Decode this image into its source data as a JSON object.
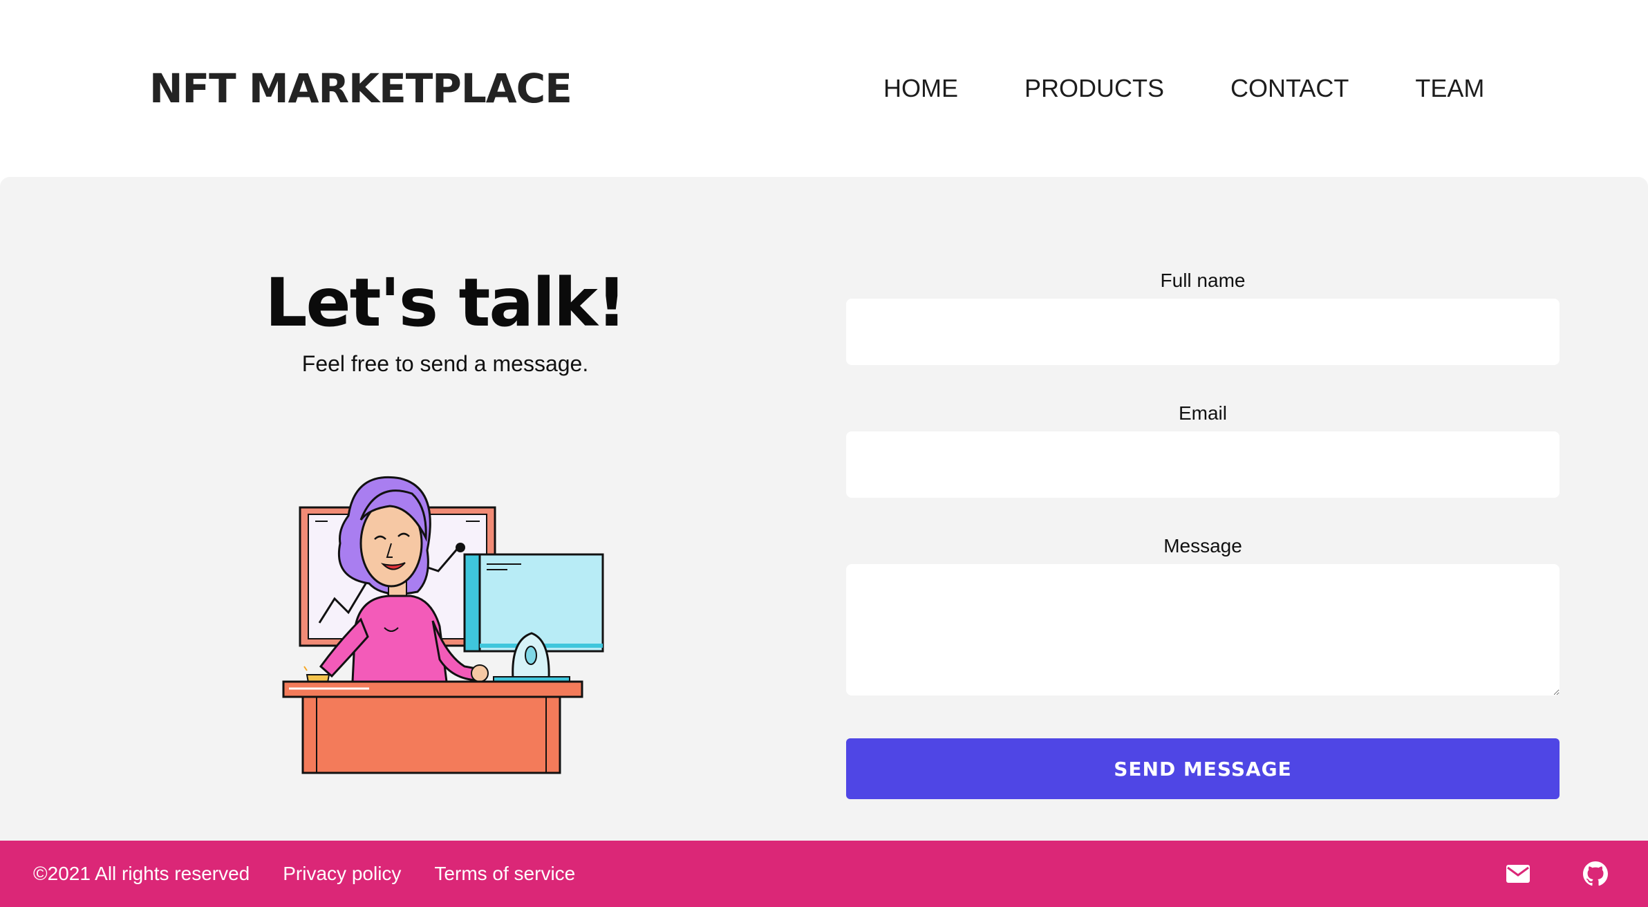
{
  "header": {
    "logo": "NFT MARKETPLACE",
    "nav": [
      {
        "label": "HOME"
      },
      {
        "label": "PRODUCTS"
      },
      {
        "label": "CONTACT"
      },
      {
        "label": "TEAM"
      }
    ]
  },
  "hero": {
    "title": "Let's talk!",
    "subtitle": "Feel free to send a message."
  },
  "form": {
    "full_name_label": "Full name",
    "full_name_value": "",
    "email_label": "Email",
    "email_value": "",
    "message_label": "Message",
    "message_value": "",
    "submit_label": "SEND MESSAGE"
  },
  "footer": {
    "copyright": "©2021 All rights reserved",
    "privacy": "Privacy policy",
    "terms": "Terms of service",
    "icons": [
      "mail-icon",
      "github-icon"
    ]
  },
  "colors": {
    "accent_button": "#4f46e5",
    "footer_bg": "#db2777",
    "main_bg": "#f3f3f3"
  }
}
